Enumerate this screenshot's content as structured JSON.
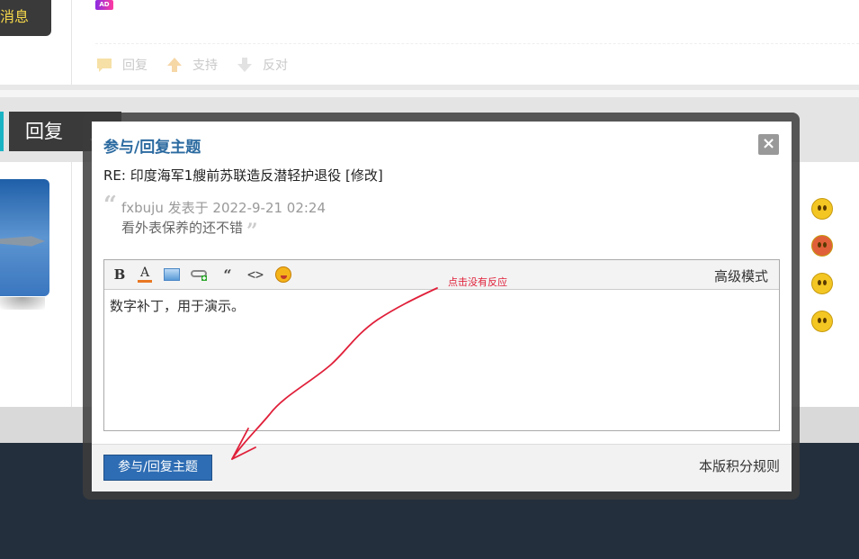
{
  "background": {
    "message_button": "消息",
    "ad_badge": "AD",
    "post_actions": {
      "reply": "回复",
      "support": "支持",
      "oppose": "反对"
    },
    "reply_button": "回复"
  },
  "modal": {
    "title": "参与/回复主题",
    "close_icon": "×",
    "re_line": "RE: 印度海军1艘前苏联造反潜轻护退役 [修改]",
    "quote": {
      "author_line": "fxbuju 发表于 2022-9-21 02:24",
      "text": "看外表保养的还不错"
    },
    "toolbar": {
      "bold": "B",
      "font_color": "A",
      "quote": "“",
      "code": "<>",
      "advanced_mode": "高级模式"
    },
    "editor_content": "数字补丁，用于演示。",
    "submit_button": "参与/回复主题",
    "rules_link": "本版积分规则"
  },
  "annotation": {
    "text": "点击没有反应",
    "color": "#e0203a"
  }
}
